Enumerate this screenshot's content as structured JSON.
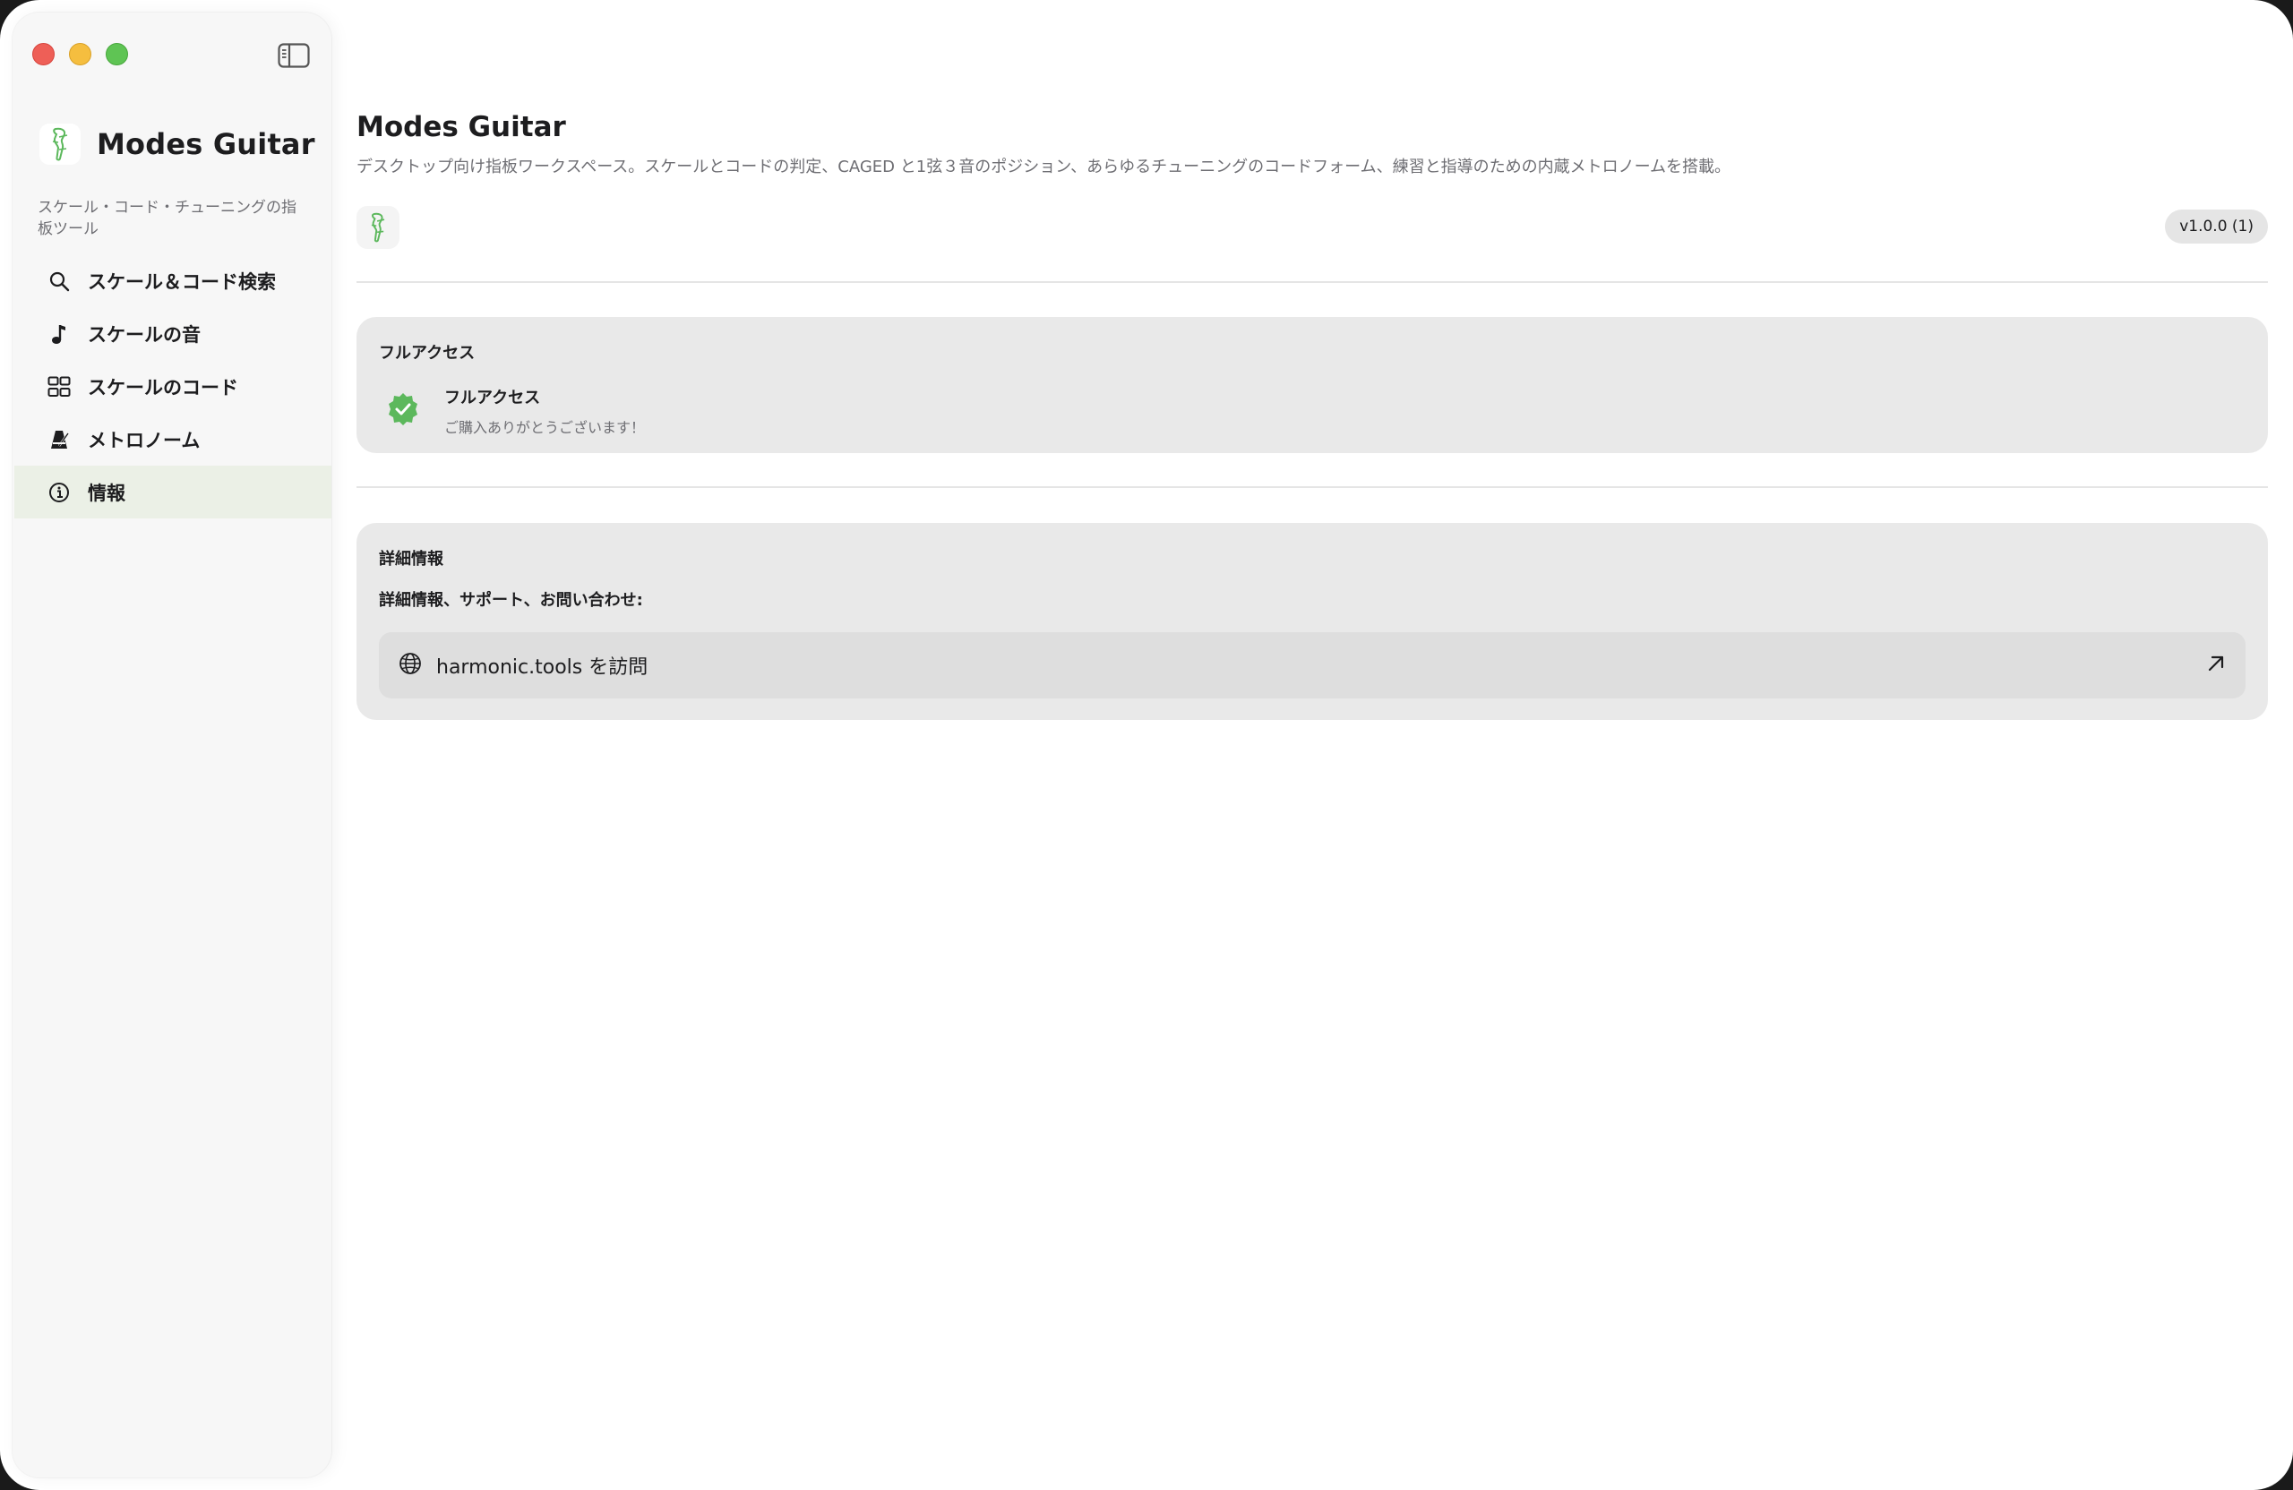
{
  "sidebar": {
    "brand_name": "Modes Guitar",
    "brand_subtitle": "スケール・コード・チューニングの指板ツール",
    "items": [
      {
        "label": "スケール＆コード検索",
        "icon": "search-icon"
      },
      {
        "label": "スケールの音",
        "icon": "music-note-icon"
      },
      {
        "label": "スケールのコード",
        "icon": "grid-icon"
      },
      {
        "label": "メトロノーム",
        "icon": "metronome-icon"
      },
      {
        "label": "情報",
        "icon": "info-icon",
        "active": true
      }
    ]
  },
  "main": {
    "title": "Modes Guitar",
    "description": "デスクトップ向け指板ワークスペース。スケールとコードの判定、CAGED と1弦３音のポジション、あらゆるチューニングのコードフォーム、練習と指導のための内蔵メトロノームを搭載。",
    "version": "v1.0.0 (1)",
    "access_card": {
      "title": "フルアクセス",
      "status_label": "フルアクセス",
      "thanks": "ご購入ありがとうございます！"
    },
    "details_card": {
      "title": "詳細情報",
      "text": "詳細情報、サポート、お問い合わせ:",
      "link_label": "harmonic.tools を訪問"
    }
  },
  "colors": {
    "accent_green": "#5cb85c",
    "active_bg": "#ebf0e6"
  }
}
